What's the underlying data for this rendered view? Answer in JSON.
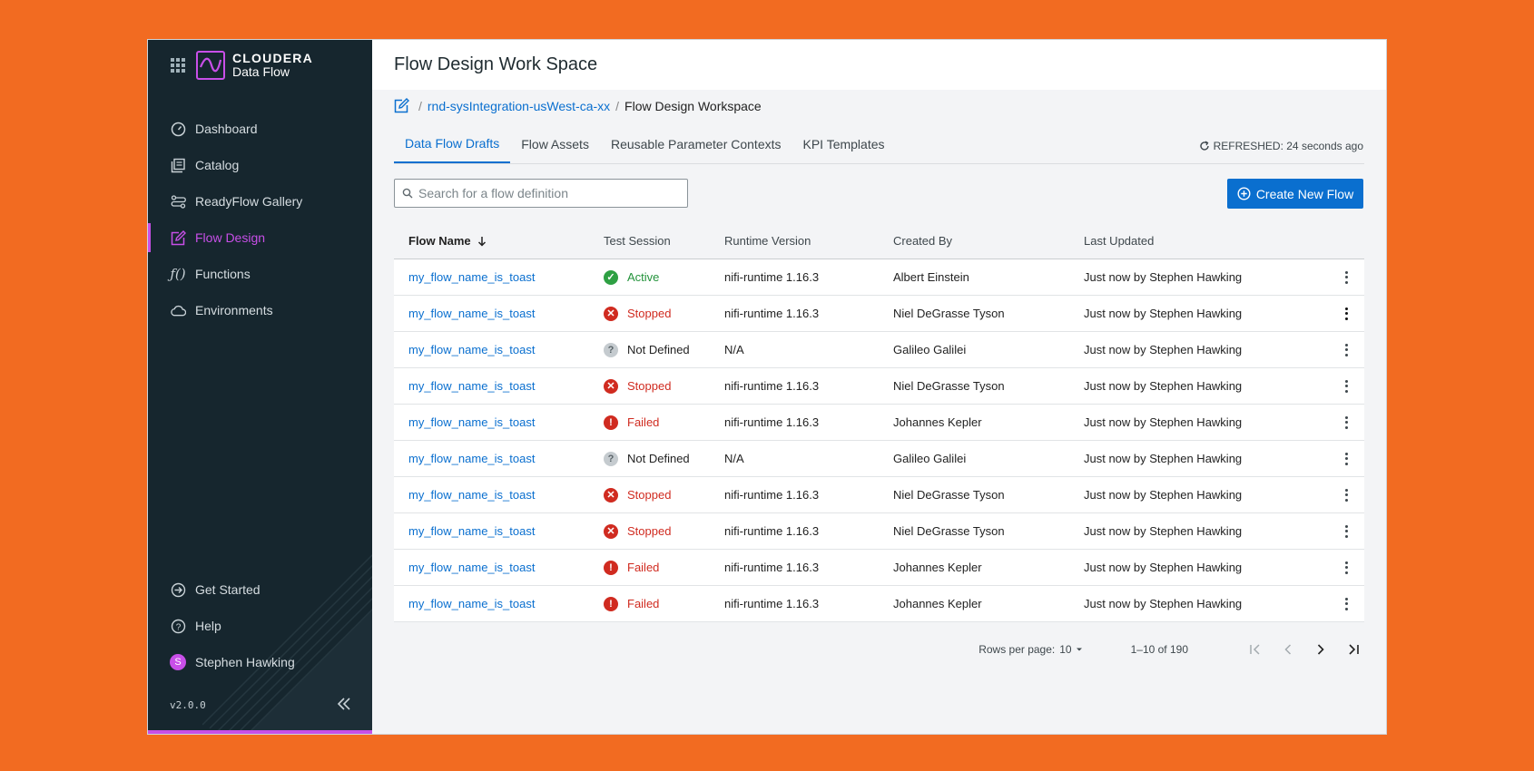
{
  "brand": {
    "name": "CLOUDERA",
    "product": "Data Flow"
  },
  "sidebar": {
    "items": [
      {
        "label": "Dashboard",
        "icon": "dashboard-icon"
      },
      {
        "label": "Catalog",
        "icon": "catalog-icon"
      },
      {
        "label": "ReadyFlow Gallery",
        "icon": "readyflow-icon"
      },
      {
        "label": "Flow Design",
        "icon": "flow-design-icon",
        "active": true
      },
      {
        "label": "Functions",
        "icon": "functions-icon"
      },
      {
        "label": "Environments",
        "icon": "cloud-icon"
      }
    ],
    "bottom": [
      {
        "label": "Get Started",
        "icon": "get-started-icon"
      },
      {
        "label": "Help",
        "icon": "help-icon"
      },
      {
        "label": "Stephen Hawking",
        "avatar": "S"
      }
    ],
    "version": "v2.0.0"
  },
  "header": {
    "title": "Flow Design Work Space"
  },
  "breadcrumb": {
    "environment": "rnd-sysIntegration-usWest-ca-xx",
    "current": "Flow Design Workspace"
  },
  "tabs": [
    "Data Flow Drafts",
    "Flow Assets",
    "Reusable Parameter Contexts",
    "KPI Templates"
  ],
  "refreshed": "REFRESHED: 24 seconds ago",
  "search": {
    "placeholder": "Search for a flow definition"
  },
  "create_button": "Create New Flow",
  "table": {
    "columns": [
      "Flow Name",
      "Test Session",
      "Runtime Version",
      "Created By",
      "Last Updated"
    ],
    "rows": [
      {
        "name": "my_flow_name_is_toast",
        "status": "Active",
        "runtime": "nifi-runtime 1.16.3",
        "created": "Albert Einstein",
        "updated": "Just now by Stephen Hawking"
      },
      {
        "name": "my_flow_name_is_toast",
        "status": "Stopped",
        "runtime": "nifi-runtime 1.16.3",
        "created": "Niel DeGrasse Tyson",
        "updated": "Just now by Stephen Hawking"
      },
      {
        "name": "my_flow_name_is_toast",
        "status": "Not Defined",
        "runtime": "N/A",
        "created": "Galileo Galilei",
        "updated": "Just now by Stephen Hawking"
      },
      {
        "name": "my_flow_name_is_toast",
        "status": "Stopped",
        "runtime": "nifi-runtime 1.16.3",
        "created": "Niel DeGrasse Tyson",
        "updated": "Just now by Stephen Hawking"
      },
      {
        "name": "my_flow_name_is_toast",
        "status": "Failed",
        "runtime": "nifi-runtime 1.16.3",
        "created": "Johannes Kepler",
        "updated": "Just now by Stephen Hawking"
      },
      {
        "name": "my_flow_name_is_toast",
        "status": "Not Defined",
        "runtime": "N/A",
        "created": "Galileo Galilei",
        "updated": "Just now by Stephen Hawking"
      },
      {
        "name": "my_flow_name_is_toast",
        "status": "Stopped",
        "runtime": "nifi-runtime 1.16.3",
        "created": "Niel DeGrasse Tyson",
        "updated": "Just now by Stephen Hawking"
      },
      {
        "name": "my_flow_name_is_toast",
        "status": "Stopped",
        "runtime": "nifi-runtime 1.16.3",
        "created": "Niel DeGrasse Tyson",
        "updated": "Just now by Stephen Hawking"
      },
      {
        "name": "my_flow_name_is_toast",
        "status": "Failed",
        "runtime": "nifi-runtime 1.16.3",
        "created": "Johannes Kepler",
        "updated": "Just now by Stephen Hawking"
      },
      {
        "name": "my_flow_name_is_toast",
        "status": "Failed",
        "runtime": "nifi-runtime 1.16.3",
        "created": "Johannes Kepler",
        "updated": "Just now by Stephen Hawking"
      }
    ]
  },
  "pagination": {
    "rows_per_page_label": "Rows per page:",
    "rows_per_page": "10",
    "range": "1–10 of 190"
  },
  "colors": {
    "accent": "#C84FE8",
    "primary": "#0A6FCF",
    "sidebar": "#16262E",
    "background": "#F26B21",
    "success": "#2EA043",
    "error": "#D02B20"
  }
}
